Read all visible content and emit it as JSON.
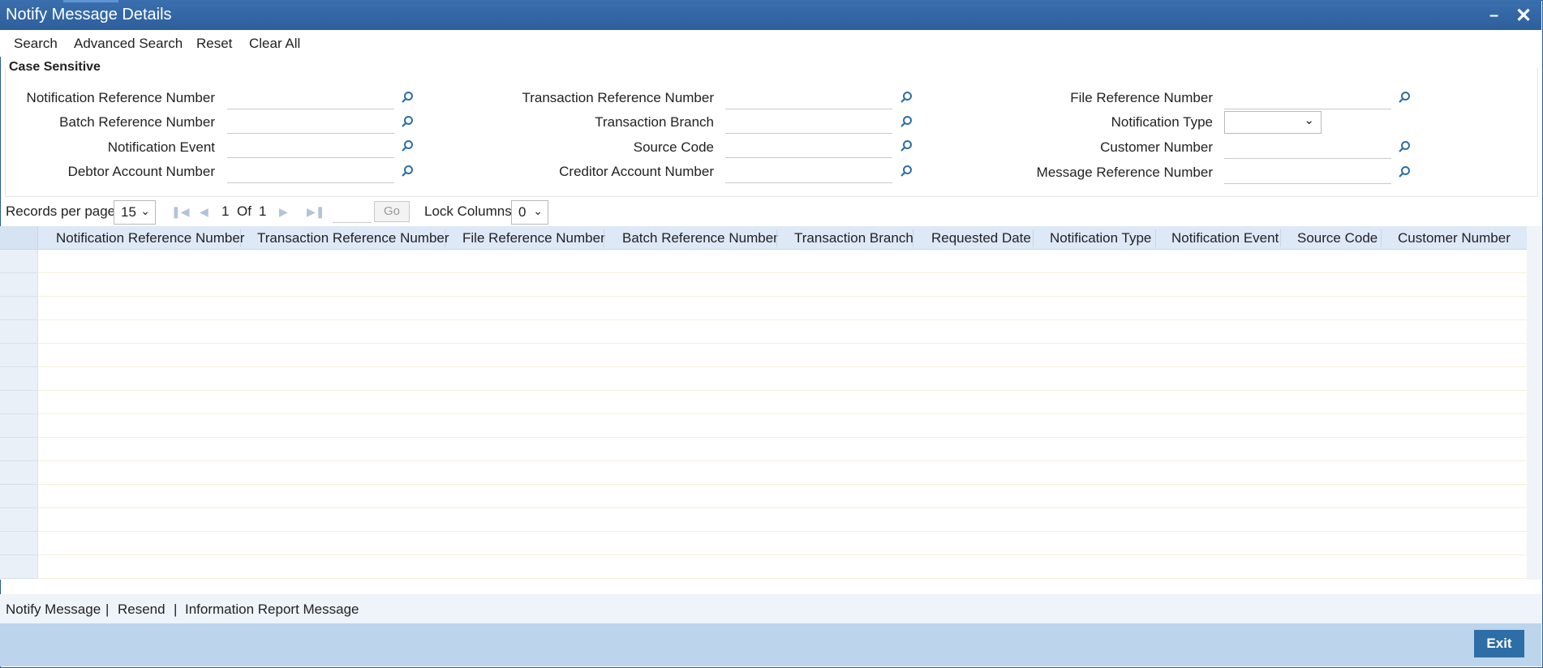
{
  "window": {
    "title": "Notify Message Details"
  },
  "toolbar": {
    "search": "Search",
    "advanced_search": "Advanced Search",
    "reset": "Reset",
    "clear_all": "Clear All"
  },
  "criteria": {
    "legend": "Case Sensitive",
    "notification_reference_number": "Notification Reference Number",
    "batch_reference_number": "Batch Reference Number",
    "notification_event": "Notification Event",
    "debtor_account_number": "Debtor Account Number",
    "transaction_reference_number": "Transaction Reference Number",
    "transaction_branch": "Transaction Branch",
    "source_code": "Source Code",
    "creditor_account_number": "Creditor Account Number",
    "file_reference_number": "File Reference Number",
    "notification_type": "Notification Type",
    "customer_number": "Customer Number",
    "message_reference_number": "Message Reference Number",
    "notification_type_value": ""
  },
  "pager": {
    "records_per_page_label": "Records per page",
    "records_per_page_value": "15",
    "current_page": "1",
    "of_label": "Of",
    "total_pages": "1",
    "go_label": "Go",
    "lock_columns_label": "Lock Columns",
    "lock_columns_value": "0"
  },
  "grid": {
    "columns": [
      "Notification Reference Number",
      "Transaction Reference Number",
      "File Reference Number",
      "Batch Reference Number",
      "Transaction Branch",
      "Requested Date",
      "Notification Type",
      "Notification Event",
      "Source Code",
      "Customer Number"
    ],
    "rows": []
  },
  "footer": {
    "links": [
      "Notify Message",
      "Resend",
      "Information Report Message"
    ],
    "separator": "|",
    "exit": "Exit"
  },
  "colors": {
    "titlebar": "#2d5f9c",
    "accent": "#2e6ea6",
    "bottom_bar": "#bcd5ec"
  },
  "icons": {
    "lookup": "search-icon",
    "minimize": "minimize-icon",
    "close": "close-icon"
  }
}
